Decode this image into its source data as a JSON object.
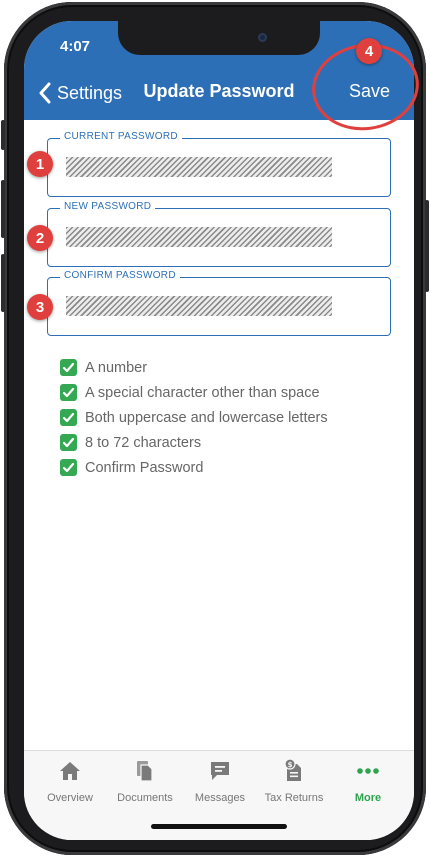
{
  "status_bar": {
    "time": "4:07"
  },
  "nav": {
    "back_label": "Settings",
    "title": "Update Password",
    "save_label": "Save"
  },
  "fields": [
    {
      "label": "CURRENT PASSWORD"
    },
    {
      "label": "NEW PASSWORD"
    },
    {
      "label": "CONFIRM PASSWORD"
    }
  ],
  "requirements": [
    {
      "text": "A number",
      "checked": true
    },
    {
      "text": "A special character other than space",
      "checked": true
    },
    {
      "text": "Both uppercase and lowercase letters",
      "checked": true
    },
    {
      "text": "8 to 72 characters",
      "checked": true
    },
    {
      "text": "Confirm Password",
      "checked": true
    }
  ],
  "tabs": [
    {
      "label": "Overview",
      "icon": "home-icon"
    },
    {
      "label": "Documents",
      "icon": "documents-icon"
    },
    {
      "label": "Messages",
      "icon": "messages-icon"
    },
    {
      "label": "Tax Returns",
      "icon": "tax-returns-icon"
    },
    {
      "label": "More",
      "icon": "more-icon",
      "active": true
    }
  ],
  "annotations": [
    "1",
    "2",
    "3",
    "4"
  ],
  "colors": {
    "brand_blue": "#2d6fb6",
    "check_green": "#34a853",
    "active_tab_green": "#2ea44f",
    "annotation_red": "#e0403d"
  }
}
